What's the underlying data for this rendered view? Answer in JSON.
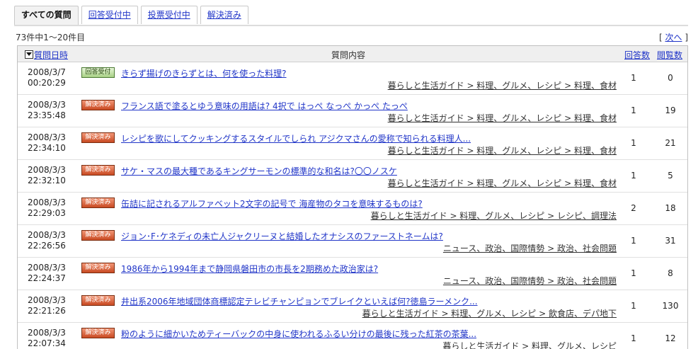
{
  "tabs": [
    {
      "label": "すべての質問",
      "active": true
    },
    {
      "label": "回答受付中",
      "active": false
    },
    {
      "label": "投票受付中",
      "active": false
    },
    {
      "label": "解決済み",
      "active": false
    }
  ],
  "result_count": "73件中1～20件目",
  "pager": {
    "open": "[ ",
    "next_label": "次へ",
    "close": " ]"
  },
  "header": {
    "date": "質問日時",
    "content": "質問内容",
    "answers": "回答数",
    "views": "閲覧数"
  },
  "rows": [
    {
      "date": "2008/3/7",
      "time": "00:20:29",
      "status": "回答受付",
      "status_type": "open",
      "question": "きらず揚げのきらずとは、何を使った料理?",
      "category": "暮らしと生活ガイド > 料理、グルメ、レシピ > 料理、食材",
      "answers": "1",
      "views": "0"
    },
    {
      "date": "2008/3/3",
      "time": "23:35:48",
      "status": "解決済み",
      "status_type": "solved",
      "question": "フランス語で塗るとゆう意味の用語は? 4択で はっぺ なっぺ かっぺ たっぺ",
      "category": "暮らしと生活ガイド > 料理、グルメ、レシピ > 料理、食材",
      "answers": "1",
      "views": "19"
    },
    {
      "date": "2008/3/3",
      "time": "22:34:10",
      "status": "解決済み",
      "status_type": "solved",
      "question": "レシピを歌にしてクッキングするスタイルでしられ アジクマさんの愛称で知られる料理人...",
      "category": "暮らしと生活ガイド > 料理、グルメ、レシピ > 料理、食材",
      "answers": "1",
      "views": "21"
    },
    {
      "date": "2008/3/3",
      "time": "22:32:10",
      "status": "解決済み",
      "status_type": "solved",
      "question": "サケ・マスの最大種であるキングサーモンの標準的な和名は?〇〇ノスケ",
      "category": "暮らしと生活ガイド > 料理、グルメ、レシピ > 料理、食材",
      "answers": "1",
      "views": "5"
    },
    {
      "date": "2008/3/3",
      "time": "22:29:03",
      "status": "解決済み",
      "status_type": "solved",
      "question": "缶詰に記されるアルファベット2文字の記号で 海産物のタコを意味するものは?",
      "category": "暮らしと生活ガイド > 料理、グルメ、レシピ > レシピ、調理法",
      "answers": "2",
      "views": "18"
    },
    {
      "date": "2008/3/3",
      "time": "22:26:56",
      "status": "解決済み",
      "status_type": "solved",
      "question": "ジョン･F･ケネディの未亡人ジャクリーヌと結婚したオナシスのファーストネームは?",
      "category": "ニュース、政治、国際情勢 > 政治、社会問題",
      "answers": "1",
      "views": "31"
    },
    {
      "date": "2008/3/3",
      "time": "22:24:37",
      "status": "解決済み",
      "status_type": "solved",
      "question": "1986年から1994年まで静岡県磐田市の市長を2期務めた政治家は?",
      "category": "ニュース、政治、国際情勢 > 政治、社会問題",
      "answers": "1",
      "views": "8"
    },
    {
      "date": "2008/3/3",
      "time": "22:21:26",
      "status": "解決済み",
      "status_type": "solved",
      "question": "井出系2006年地域団体商標認定テレビチャンピョンでブレイクといえば何?徳島ラーメンク...",
      "category": "暮らしと生活ガイド > 料理、グルメ、レシピ > 飲食店、デパ地下",
      "answers": "1",
      "views": "130"
    },
    {
      "date": "2008/3/3",
      "time": "22:07:34",
      "status": "解決済み",
      "status_type": "solved",
      "question": "粉のように細かいためティーバックの中身に使われるふるい分けの最後に残った紅茶の茶葉...",
      "category": "暮らしと生活ガイド > 料理、グルメ、レシピ",
      "answers": "1",
      "views": "12"
    }
  ]
}
